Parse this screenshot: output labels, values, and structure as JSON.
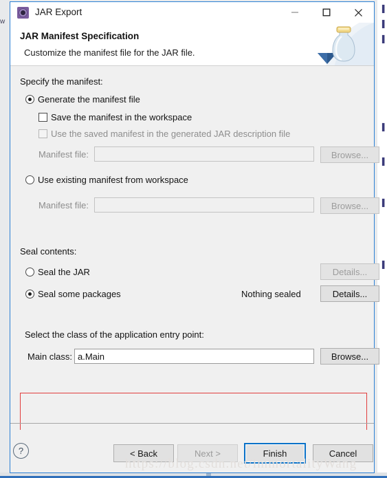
{
  "window": {
    "title": "JAR Export",
    "app_icon": "jar-export-icon",
    "minimize_label": "–",
    "maximize_label": "□",
    "close_label": "✕"
  },
  "header": {
    "title": "JAR Manifest Specification",
    "subtitle": "Customize the manifest file for the JAR file.",
    "artwork": "jar-jar-illustration"
  },
  "manifest": {
    "group_label": "Specify the manifest:",
    "generate_option": "Generate the manifest file",
    "generate_selected": true,
    "save_in_workspace": "Save the manifest in the workspace",
    "save_in_workspace_checked": false,
    "use_saved_manifest": "Use the saved manifest in the generated JAR description file",
    "use_saved_manifest_checked": false,
    "use_saved_manifest_enabled": false,
    "manifest_file_label_1": "Manifest file:",
    "manifest_file_value_1": "",
    "browse_1": "Browse...",
    "use_existing_option": "Use existing manifest from workspace",
    "use_existing_selected": false,
    "manifest_file_label_2": "Manifest file:",
    "manifest_file_value_2": "",
    "browse_2": "Browse..."
  },
  "seal": {
    "group_label": "Seal contents:",
    "seal_jar_option": "Seal the JAR",
    "seal_jar_selected": false,
    "seal_jar_details": "Details...",
    "seal_packages_option": "Seal some packages",
    "seal_packages_selected": true,
    "sealed_status": "Nothing sealed",
    "seal_packages_details": "Details..."
  },
  "entry_point": {
    "group_label": "Select the class of the application entry point:",
    "main_class_label": "Main class:",
    "main_class_value": "a.Main",
    "browse": "Browse...",
    "highlight_color": "#e13c3c"
  },
  "footer": {
    "help_label": "?",
    "back": "< Back",
    "next": "Next >",
    "next_enabled": false,
    "finish": "Finish",
    "finish_focused": true,
    "cancel": "Cancel",
    "focus_color": "#0a72c8"
  },
  "watermark": {
    "text": "https://blog.csdn.net/immortalityWang"
  },
  "background": {
    "left_fragment": "w",
    "right_fragments": [
      "▌",
      "▌",
      "▌",
      "▌",
      "▌",
      "▌",
      "▌"
    ]
  }
}
